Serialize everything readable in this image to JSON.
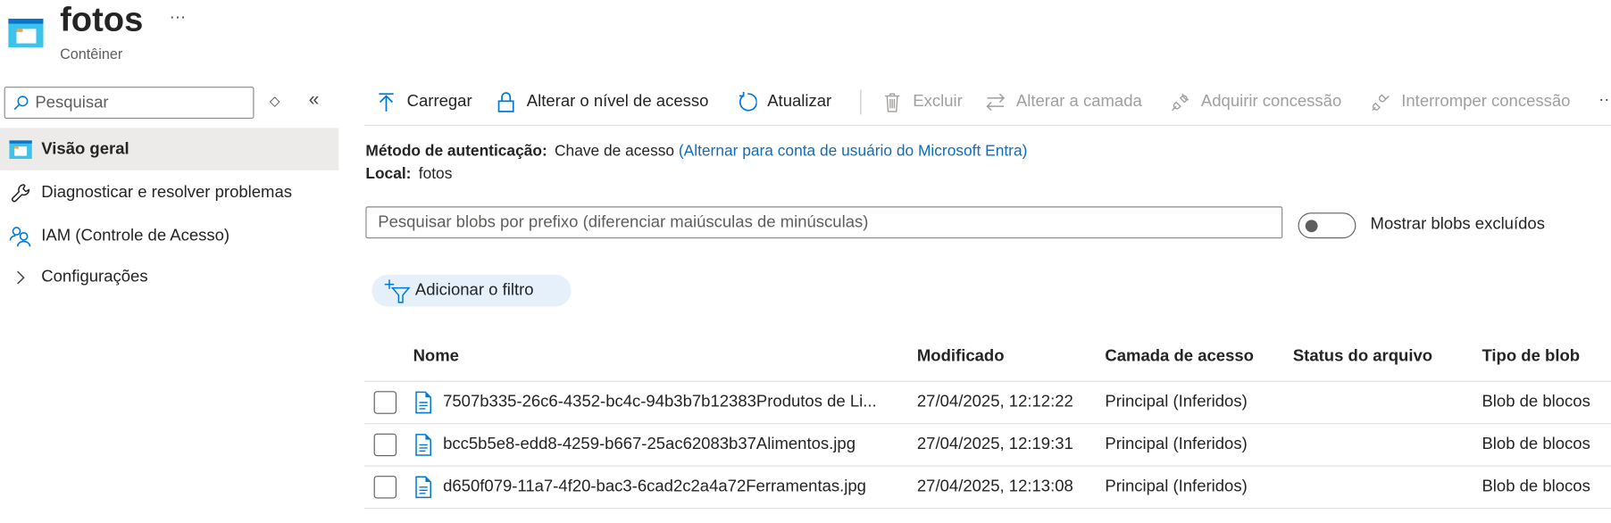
{
  "header": {
    "title": "fotos",
    "subtitle": "Contêiner",
    "more": "···"
  },
  "sidebar": {
    "search_placeholder": "Pesquisar",
    "items": [
      {
        "label": "Visão geral",
        "icon": "container-icon",
        "selected": true
      },
      {
        "label": "Diagnosticar e resolver problemas",
        "icon": "wrench-icon"
      },
      {
        "label": "IAM (Controle de Acesso)",
        "icon": "people-icon"
      },
      {
        "label": "Configurações",
        "icon": "chevron-right-icon"
      }
    ]
  },
  "toolbar": {
    "upload": "Carregar",
    "access_level": "Alterar o nível de acesso",
    "refresh": "Atualizar",
    "delete": "Excluir",
    "change_tier": "Alterar a camada",
    "acquire_lease": "Adquirir concessão",
    "break_lease": "Interromper concessão",
    "more": "···"
  },
  "info": {
    "auth_label": "Método de autenticação:",
    "auth_value": "Chave de acesso",
    "auth_link": "(Alternar para conta de usuário do Microsoft Entra)",
    "location_label": "Local:",
    "location_value": "fotos"
  },
  "blob_search": {
    "placeholder": "Pesquisar blobs por prefixo (diferenciar maiúsculas de minúsculas)",
    "value": ""
  },
  "show_deleted": {
    "label": "Mostrar blobs excluídos",
    "on": false
  },
  "filter_button": "Adicionar o filtro",
  "table": {
    "columns": [
      "Nome",
      "Modificado",
      "Camada de acesso",
      "Status do arquivo",
      "Tipo de blob"
    ],
    "rows": [
      {
        "name": "7507b335-26c6-4352-bc4c-94b3b7b12383Produtos de Li...",
        "modified": "27/04/2025, 12:12:22",
        "tier": "Principal (Inferidos)",
        "status": "",
        "type": "Blob de blocos"
      },
      {
        "name": "bcc5b5e8-edd8-4259-b667-25ac62083b37Alimentos.jpg",
        "modified": "27/04/2025, 12:19:31",
        "tier": "Principal (Inferidos)",
        "status": "",
        "type": "Blob de blocos"
      },
      {
        "name": "d650f079-11a7-4f20-bac3-6cad2c2a4a72Ferramentas.jpg",
        "modified": "27/04/2025, 12:13:08",
        "tier": "Principal (Inferidos)",
        "status": "",
        "type": "Blob de blocos"
      }
    ]
  },
  "colors": {
    "accent": "#0078d4",
    "link": "#0f6cbd",
    "selected_bg": "#edebe9",
    "filter_bg": "#e5f0fb"
  }
}
